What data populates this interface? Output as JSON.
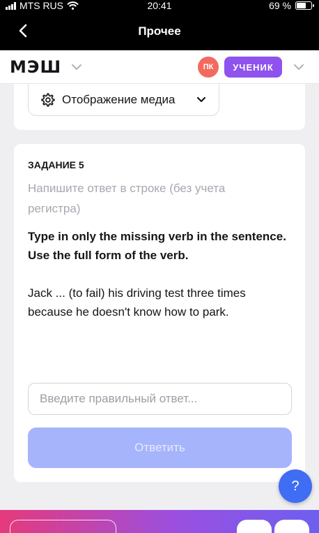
{
  "status_bar": {
    "carrier": "MTS RUS",
    "time": "20:41",
    "battery": "69 %",
    "battery_level": 0.69
  },
  "nav": {
    "title": "Прочее",
    "back_icon": "chevron-left-icon"
  },
  "header": {
    "logo": "МЭШ",
    "avatar_initials": "ПК",
    "role_badge": "УЧЕНИК"
  },
  "media": {
    "label": "Отображение медиа",
    "icon": "gear-icon"
  },
  "task": {
    "number": "ЗАДАНИЕ 5",
    "hint": "Напишите ответ в строке (без учета регистра)",
    "instruction": "Type in only the missing verb in the sentence. Use the full form of the verb.",
    "text": "Jack ... (to fail) his driving test three times because he doesn't know how to park.",
    "input_placeholder": "Введите правильный ответ...",
    "input_value": "",
    "submit_label": "Ответить"
  },
  "help": {
    "label": "?"
  },
  "colors": {
    "accent": "#8e52ee",
    "avatar": "#f26a5e",
    "submit": "#a6b4fb",
    "help": "#3f6df4"
  }
}
